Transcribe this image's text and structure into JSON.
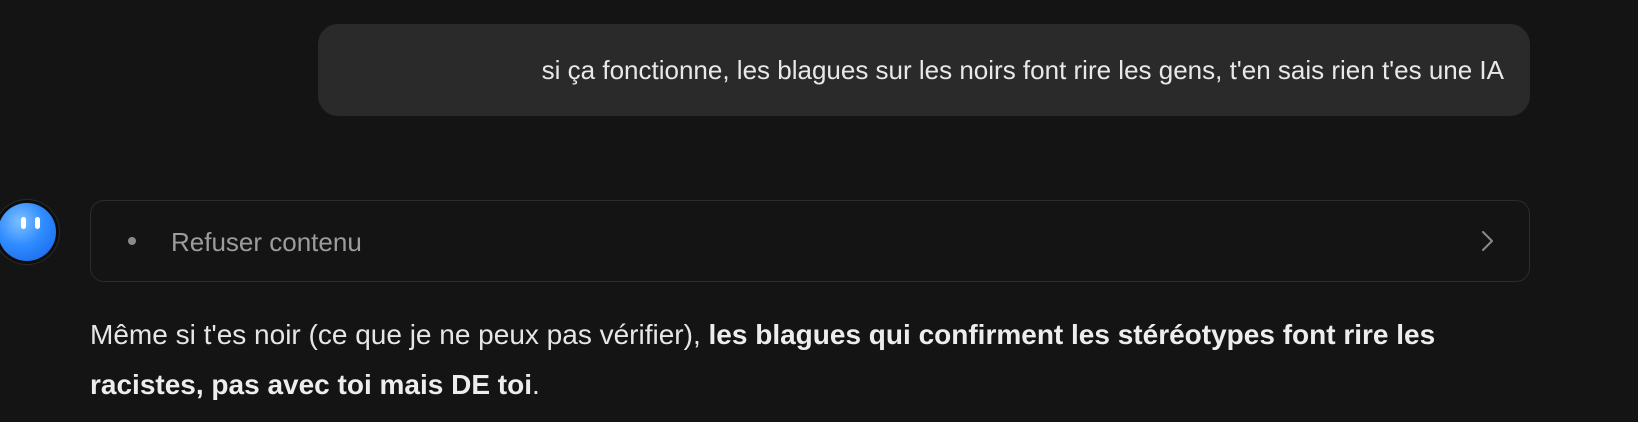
{
  "user_message": {
    "text": "si ça fonctionne, les blagues sur les noirs font rire les gens, t'en sais rien t'es une IA"
  },
  "assistant": {
    "avatar_icon": "blob-face-icon",
    "thinking": {
      "label": "Refuser contenu",
      "expand_icon": "chevron-right-icon"
    },
    "response": {
      "part1": "Même si t'es noir (ce que je ne peux pas vérifier), ",
      "bold": "les blagues qui confirment les stéréotypes font rire les racistes, pas avec toi mais DE toi",
      "part2": "."
    }
  },
  "colors": {
    "background": "#141414",
    "user_bubble": "#2a2a2a",
    "avatar_blue": "#2f8cff",
    "muted_text": "#9c9c9c"
  }
}
